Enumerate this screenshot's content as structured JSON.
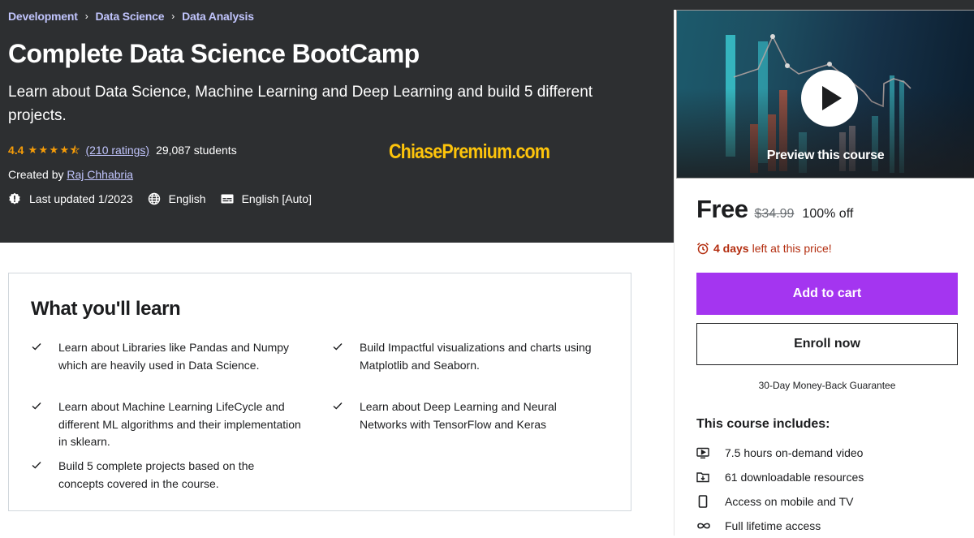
{
  "breadcrumb": [
    "Development",
    "Data Science",
    "Data Analysis"
  ],
  "course": {
    "title": "Complete Data Science BootCamp",
    "subtitle": "Learn about Data Science, Machine Learning and Deep Learning and build 5 different projects.",
    "rating": "4.4",
    "rating_value": 4.4,
    "rating_max": 5,
    "ratings_count": "(210 ratings)",
    "students": "29,087 students",
    "created_by_label": "Created by",
    "instructor": "Raj Chhabria",
    "last_updated": "Last updated 1/2023",
    "language": "English",
    "captions": "English [Auto]"
  },
  "watermark": "ChiasePremium.com",
  "sidebar": {
    "preview_label": "Preview this course",
    "price": "Free",
    "original_price": "$34.99",
    "discount": "100% off",
    "timer_bold": "4 days",
    "timer_rest": "left at this price!",
    "add_to_cart": "Add to cart",
    "enroll_now": "Enroll now",
    "guarantee": "30-Day Money-Back Guarantee",
    "includes_title": "This course includes:",
    "includes": [
      {
        "icon": "video-icon",
        "label": "7.5 hours on-demand video"
      },
      {
        "icon": "download-folder-icon",
        "label": "61 downloadable resources"
      },
      {
        "icon": "mobile-icon",
        "label": "Access on mobile and TV"
      },
      {
        "icon": "infinity-icon",
        "label": "Full lifetime access"
      }
    ]
  },
  "learn": {
    "title": "What you'll learn",
    "items": [
      "Learn about Libraries like Pandas and Numpy which are heavily used in Data Science.",
      "Build Impactful visualizations and charts using Matplotlib and Seaborn.",
      "Learn about Machine Learning LifeCycle and different ML algorithms and their implementation in sklearn.",
      "Learn about Deep Learning and Neural Networks with TensorFlow and Keras",
      "Build 5 complete projects based on the concepts covered in the course."
    ]
  },
  "colors": {
    "header_bg": "#2d2f31",
    "link": "#c0c4fc",
    "rating": "#f69c08",
    "accent": "#a435f0",
    "urgency": "#b32d0f",
    "watermark": "#fdc40b"
  }
}
